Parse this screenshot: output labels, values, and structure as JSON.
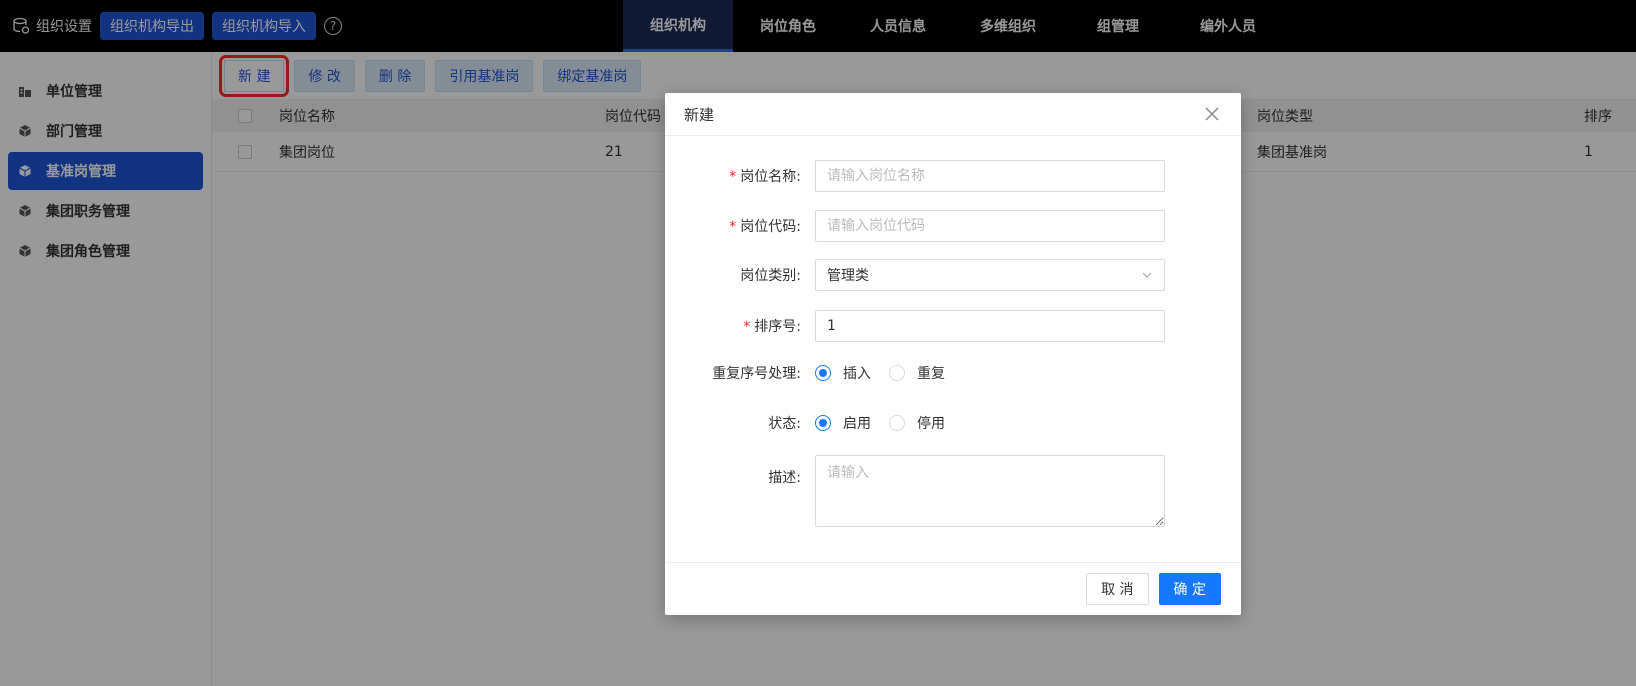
{
  "topbar": {
    "brand": "组织设置",
    "export_btn": "组织机构导出",
    "import_btn": "组织机构导入",
    "help": "?",
    "nav": [
      "组织机构",
      "岗位角色",
      "人员信息",
      "多维组织",
      "组管理",
      "编外人员"
    ]
  },
  "sidebar": {
    "items": [
      {
        "label": "单位管理",
        "icon": "building-icon"
      },
      {
        "label": "部门管理",
        "icon": "cube-icon"
      },
      {
        "label": "基准岗管理",
        "icon": "cube-icon"
      },
      {
        "label": "集团职务管理",
        "icon": "cube-icon"
      },
      {
        "label": "集团角色管理",
        "icon": "cube-icon"
      }
    ],
    "active_index": 2
  },
  "toolbar": {
    "new": "新 建",
    "edit": "修 改",
    "delete": "删 除",
    "reference": "引用基准岗",
    "bind": "绑定基准岗"
  },
  "table": {
    "columns": [
      "岗位名称",
      "岗位代码",
      "岗位类型",
      "排序"
    ],
    "rows": [
      {
        "name": "集团岗位",
        "code": "21",
        "type": "集团基准岗",
        "order": "1"
      }
    ]
  },
  "modal": {
    "title": "新建",
    "name_label": "岗位名称:",
    "name_placeholder": "请输入岗位名称",
    "code_label": "岗位代码:",
    "code_placeholder": "请输入岗位代码",
    "category_label": "岗位类别:",
    "category_value": "管理类",
    "order_label": "排序号:",
    "order_value": "1",
    "dup_label": "重复序号处理:",
    "dup_options": [
      "插入",
      "重复"
    ],
    "status_label": "状态:",
    "status_options": [
      "启用",
      "停用"
    ],
    "desc_label": "描述:",
    "desc_placeholder": "请输入",
    "cancel": "取 消",
    "ok": "确 定",
    "required_mark": "*"
  },
  "colors": {
    "primary": "#1677ff",
    "nav_blue": "#1e56d9",
    "highlight": "#ff2a2a"
  }
}
